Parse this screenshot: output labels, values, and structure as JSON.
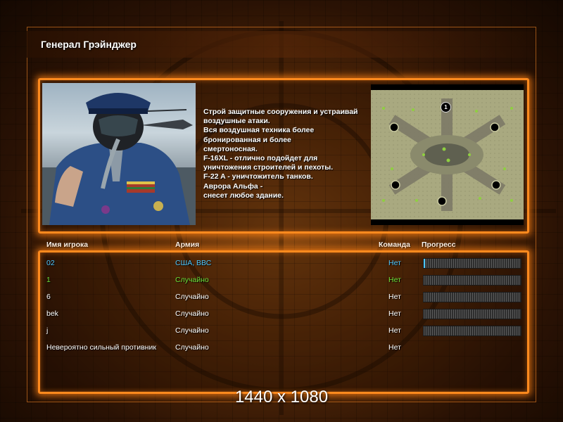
{
  "title": "Генерал Грэйнджер",
  "description": "Строй защитные сооружения и устраивай\n воздушные атаки.\nВся воздушная техника более\n бронированная и более\nсмертоносная.\nF-16XL - отлично подойдет для\n уничтожения строителей и пехоты.\nF-22 A - уничтожитель танков.\nАврора Альфа -\nснесет любое здание.",
  "minimap": {
    "marker_label": "1"
  },
  "columns": {
    "player": "Имя игрока",
    "army": "Армия",
    "team": "Команда",
    "progress": "Прогресс"
  },
  "colors": {
    "accent": "#ff8a1e",
    "cyan": "#4ec8ff",
    "green": "#6fe23a",
    "white": "#ffffff"
  },
  "players": [
    {
      "name": "02",
      "army": "США, ВВС",
      "team": "Нет",
      "progress": 0.01,
      "color": "#4ec8ff",
      "has_bar": true
    },
    {
      "name": "1",
      "army": "Случайно",
      "team": "Нет",
      "progress": 0,
      "color": "#6fe23a",
      "has_bar": true
    },
    {
      "name": "6",
      "army": "Случайно",
      "team": "Нет",
      "progress": 0,
      "color": "#ffffff",
      "has_bar": true
    },
    {
      "name": "bek",
      "army": "Случайно",
      "team": "Нет",
      "progress": 0,
      "color": "#ffffff",
      "has_bar": true
    },
    {
      "name": "j",
      "army": "Случайно",
      "team": "Нет",
      "progress": 0,
      "color": "#ffffff",
      "has_bar": true
    },
    {
      "name": "Невероятно сильный противник",
      "army": "Случайно",
      "team": "Нет",
      "progress": 0,
      "color": "#ffffff",
      "has_bar": false
    }
  ],
  "resolution_label": "1440 x 1080"
}
